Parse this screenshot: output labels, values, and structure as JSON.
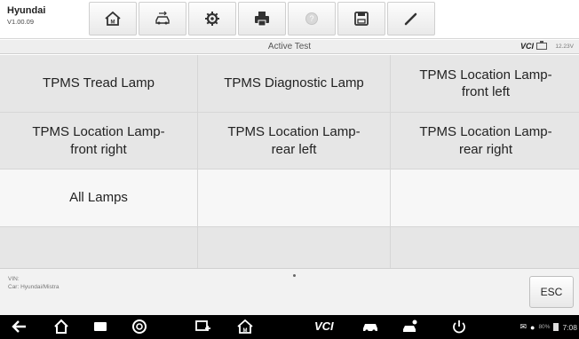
{
  "header": {
    "app_name": "Hyundai",
    "version": "V1.00.09",
    "toolbar": [
      {
        "name": "home-button",
        "icon": "home-icon"
      },
      {
        "name": "vehicle-swap-button",
        "icon": "car-swap-icon"
      },
      {
        "name": "settings-button",
        "icon": "gear-icon"
      },
      {
        "name": "print-button",
        "icon": "printer-icon"
      },
      {
        "name": "help-button",
        "icon": "help-icon"
      },
      {
        "name": "save-button",
        "icon": "floppy-disk-icon"
      },
      {
        "name": "edit-button",
        "icon": "pen-icon"
      }
    ]
  },
  "status": {
    "title": "Active Test",
    "vci": "VCI",
    "voltage": "12.23V"
  },
  "tests": [
    "TPMS Tread Lamp",
    "TPMS Diagnostic Lamp",
    "TPMS Location Lamp-\nfront left",
    "TPMS Location Lamp-\nfront right",
    "TPMS Location Lamp-\nrear left",
    "TPMS Location Lamp-\nrear right",
    "All Lamps",
    "",
    "",
    "",
    "",
    ""
  ],
  "footer": {
    "vin": "VIN:",
    "car": "Car: Hyundai/Mistra",
    "esc_label": "ESC"
  },
  "navbar": {
    "vci_label": "VCI",
    "battery_pct": "80%",
    "time": "7:08"
  },
  "colors": {
    "cell_gray": "#e6e6e6",
    "cell_light": "#f7f7f7",
    "navbar": "#000000"
  }
}
